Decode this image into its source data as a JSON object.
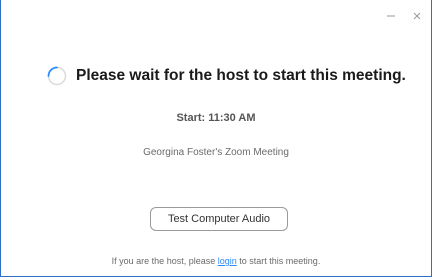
{
  "window": {
    "controls": {
      "minimize_icon": "minimize-icon",
      "close_icon": "close-icon"
    }
  },
  "status": {
    "spinner_icon": "loading-spinner-icon",
    "message": "Please wait for the host to start this meeting."
  },
  "meeting": {
    "start_time": "Start: 11:30 AM",
    "name": "Georgina Foster's Zoom Meeting"
  },
  "actions": {
    "test_audio_label": "Test Computer Audio"
  },
  "footer": {
    "text_before": "If you are the host, please",
    "login_link": "login",
    "text_after": "to start this meeting."
  },
  "colors": {
    "window_border": "#2b6fc9",
    "spinner": "#2d8cff",
    "link": "#2d8cff"
  }
}
